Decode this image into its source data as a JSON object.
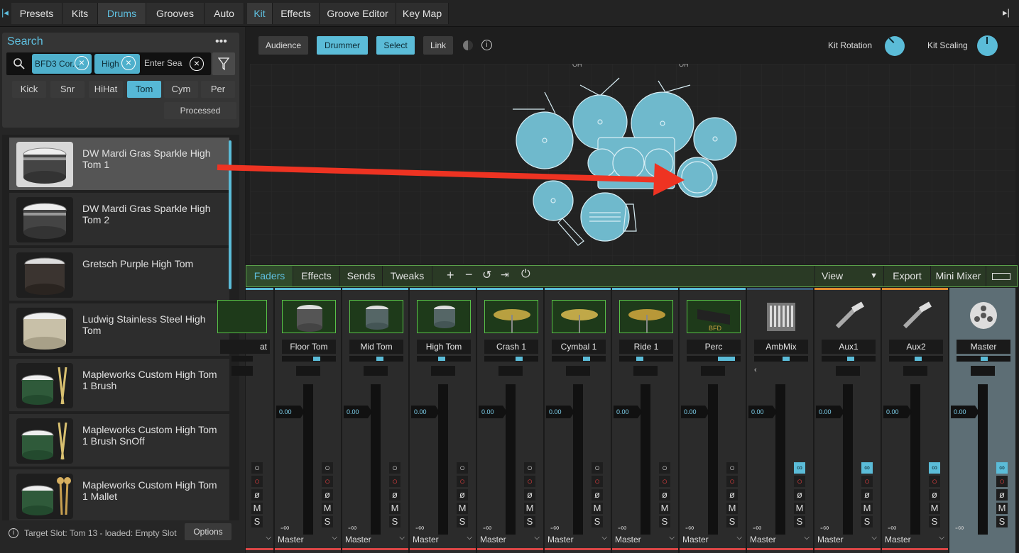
{
  "left_tabs": [
    "Presets",
    "Kits",
    "Drums",
    "Grooves",
    "Auto"
  ],
  "right_tabs": [
    "Kit",
    "Effects",
    "Groove Editor",
    "Key Map"
  ],
  "search": {
    "title": "Search",
    "more": "•••",
    "chips": [
      "BFD3 Cor...",
      "High"
    ],
    "placeholder": "Enter Sea"
  },
  "filters": [
    "Kick",
    "Snr",
    "HiHat",
    "Tom",
    "Cym",
    "Per"
  ],
  "active_filter": "Tom",
  "processed_label": "Processed",
  "items": [
    {
      "label": "DW Mardi Gras Sparkle High Tom 1"
    },
    {
      "label": "DW Mardi Gras Sparkle High Tom 2"
    },
    {
      "label": "Gretsch Purple High Tom"
    },
    {
      "label": "Ludwig Stainless Steel High Tom"
    },
    {
      "label": "Mapleworks Custom High Tom 1 Brush"
    },
    {
      "label": "Mapleworks Custom High Tom 1 Brush SnOff"
    },
    {
      "label": "Mapleworks Custom High Tom 1 Mallet"
    }
  ],
  "status": {
    "text": "Target Slot: Tom 13 - loaded: Empty Slot",
    "options": "Options"
  },
  "kit": {
    "buttons": [
      "Audience",
      "Drummer",
      "Select",
      "Link"
    ],
    "rotation_label": "Kit Rotation",
    "scaling_label": "Kit Scaling",
    "oh_label": "OH"
  },
  "mixer": {
    "tabs": [
      "Faders",
      "Effects",
      "Sends",
      "Tweaks"
    ],
    "view": "View",
    "export": "Export",
    "mini": "Mini Mixer",
    "value": "0.00",
    "inf": "-∞",
    "output": "Master",
    "channels": [
      "at",
      "Floor Tom",
      "Mid Tom",
      "High Tom",
      "Crash 1",
      "Cymbal 1",
      "Ride 1",
      "Perc",
      "AmbMix",
      "Aux1",
      "Aux2",
      "Master"
    ],
    "perc_text": "BFD"
  },
  "colors": {
    "accent": "#5bbcd8",
    "record": "#e14040",
    "arrow": "#ee3322"
  }
}
